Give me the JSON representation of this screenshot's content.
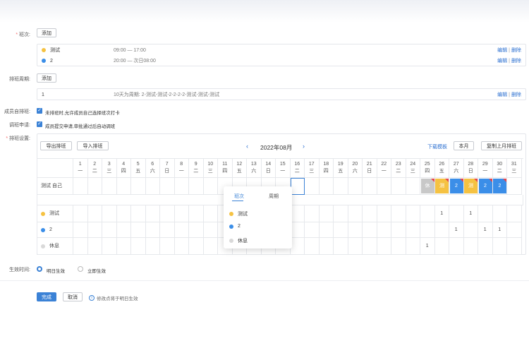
{
  "shift_section": {
    "label": "班次:",
    "add_label": "添加"
  },
  "shifts": [
    {
      "name": "测试",
      "time": "09:00 — 17:00",
      "color": "#f5c242",
      "edit": "编辑",
      "delete": "删除"
    },
    {
      "name": "2",
      "time": "20:00 — 次日08:00",
      "color": "#3b8ee8",
      "edit": "编辑",
      "delete": "删除"
    }
  ],
  "cycle_section": {
    "label": "排班周期:",
    "add_label": "添加",
    "name": "1",
    "desc": "10天为周期: 2-测试-测试-2-2-2-2-测试-测试-测试",
    "edit": "编辑",
    "delete": "删除"
  },
  "self_schedule": {
    "label": "成员自排班:",
    "text": "未排班时,允许成员自己选择班次打卡"
  },
  "swap_request": {
    "label": "调班申请:",
    "text": "成员提交申请,审批通过后自动调班"
  },
  "schedule_settings": {
    "label": "排班设置:",
    "export_label": "导出排班",
    "import_label": "导入排班",
    "prev_icon": "chevron-left-icon",
    "month": "2022年08月",
    "next_icon": "chevron-right-icon",
    "download_label": "下载模板",
    "this_month_label": "本月",
    "copy_label": "复制上月排班"
  },
  "days": [
    {
      "d": "1",
      "w": "一"
    },
    {
      "d": "2",
      "w": "二"
    },
    {
      "d": "3",
      "w": "三"
    },
    {
      "d": "4",
      "w": "四"
    },
    {
      "d": "5",
      "w": "五"
    },
    {
      "d": "6",
      "w": "六"
    },
    {
      "d": "7",
      "w": "日"
    },
    {
      "d": "8",
      "w": "一"
    },
    {
      "d": "9",
      "w": "二"
    },
    {
      "d": "10",
      "w": "三"
    },
    {
      "d": "11",
      "w": "四"
    },
    {
      "d": "12",
      "w": "五"
    },
    {
      "d": "13",
      "w": "六"
    },
    {
      "d": "14",
      "w": "日"
    },
    {
      "d": "15",
      "w": "一"
    },
    {
      "d": "16",
      "w": "二"
    },
    {
      "d": "17",
      "w": "三"
    },
    {
      "d": "18",
      "w": "四"
    },
    {
      "d": "19",
      "w": "五"
    },
    {
      "d": "20",
      "w": "六"
    },
    {
      "d": "21",
      "w": "日"
    },
    {
      "d": "22",
      "w": "一"
    },
    {
      "d": "23",
      "w": "二"
    },
    {
      "d": "24",
      "w": "三"
    },
    {
      "d": "25",
      "w": "四"
    },
    {
      "d": "26",
      "w": "五"
    },
    {
      "d": "27",
      "w": "六"
    },
    {
      "d": "28",
      "w": "日"
    },
    {
      "d": "29",
      "w": "一"
    },
    {
      "d": "30",
      "w": "二"
    },
    {
      "d": "31",
      "w": "三"
    }
  ],
  "member": {
    "name": "测试 自己"
  },
  "member_shifts": [
    {
      "day": 25,
      "text": "休",
      "color": "#c8c8c8"
    },
    {
      "day": 26,
      "text": "测",
      "color": "#f5c242"
    },
    {
      "day": 27,
      "text": "2",
      "color": "#3b8ee8"
    },
    {
      "day": 28,
      "text": "测",
      "color": "#f5c242"
    },
    {
      "day": 29,
      "text": "2",
      "color": "#3b8ee8"
    },
    {
      "day": 30,
      "text": "2",
      "color": "#3b8ee8"
    }
  ],
  "summary_rows": [
    {
      "name": "测试",
      "color": "#f5c242",
      "counts": [
        {
          "day": 26,
          "v": "1"
        },
        {
          "day": 28,
          "v": "1"
        }
      ]
    },
    {
      "name": "2",
      "color": "#3b8ee8",
      "counts": [
        {
          "day": 27,
          "v": "1"
        },
        {
          "day": 29,
          "v": "1"
        },
        {
          "day": 30,
          "v": "1"
        }
      ]
    },
    {
      "name": "休息",
      "color": "#d9d9d9",
      "counts": [
        {
          "day": 25,
          "v": "1"
        }
      ]
    }
  ],
  "popup": {
    "tab_shift": "班次",
    "tab_cycle": "周期",
    "items": [
      {
        "name": "测试",
        "color": "#f5c242"
      },
      {
        "name": "2",
        "color": "#3b8ee8"
      },
      {
        "name": "休息",
        "color": "#d9d9d9"
      }
    ]
  },
  "effective": {
    "label": "生效时间:",
    "option1": "明日生效",
    "option2": "立即生效",
    "selected": "明日生效"
  },
  "footer": {
    "done_label": "完成",
    "cancel_label": "取消",
    "note": "修改点将于明日生效"
  }
}
